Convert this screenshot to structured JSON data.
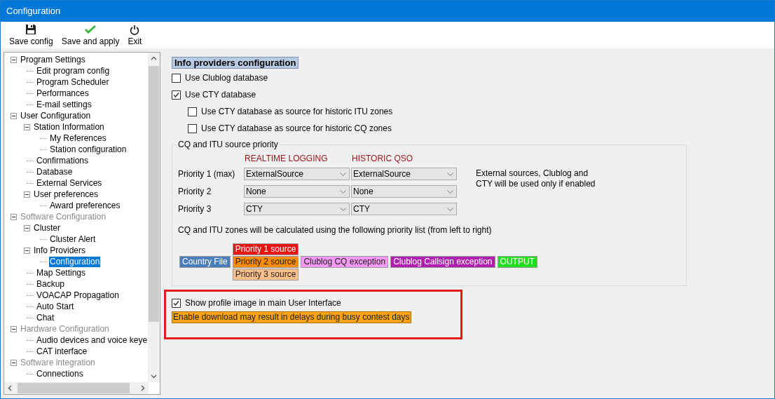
{
  "window": {
    "title": "Configuration"
  },
  "toolbar": [
    {
      "kind": "save",
      "label": "Save config"
    },
    {
      "kind": "apply",
      "label": "Save and apply"
    },
    {
      "kind": "exit",
      "label": "Exit"
    }
  ],
  "tree": [
    {
      "label": "Program Settings",
      "disabled": false,
      "expanded": true,
      "selected": false,
      "children": [
        {
          "label": "Edit program config",
          "selected": false
        },
        {
          "label": "Program Scheduler",
          "selected": false
        },
        {
          "label": "Performances",
          "selected": false
        },
        {
          "label": "E-mail settings",
          "selected": false
        }
      ]
    },
    {
      "label": "User Configuration",
      "disabled": false,
      "expanded": true,
      "selected": false,
      "children": [
        {
          "label": "Station Information",
          "expanded": true,
          "selected": false,
          "children": [
            {
              "label": "My References",
              "selected": false
            },
            {
              "label": "Station configuration",
              "selected": false
            }
          ]
        },
        {
          "label": "Confirmations",
          "selected": false
        },
        {
          "label": "Database",
          "selected": false
        },
        {
          "label": "External Services",
          "selected": false
        },
        {
          "label": "User preferences",
          "expanded": true,
          "selected": false,
          "children": [
            {
              "label": "Award preferences",
              "selected": false
            }
          ]
        }
      ]
    },
    {
      "label": "Software Configuration",
      "disabled": true,
      "expanded": true,
      "selected": false,
      "children": [
        {
          "label": "Cluster",
          "expanded": true,
          "selected": false,
          "children": [
            {
              "label": "Cluster Alert",
              "selected": false
            }
          ]
        },
        {
          "label": "Info Providers",
          "expanded": true,
          "selected": false,
          "children": [
            {
              "label": "Configuration",
              "selected": true
            }
          ]
        },
        {
          "label": "Map Settings",
          "selected": false
        },
        {
          "label": "Backup",
          "selected": false
        },
        {
          "label": "VOACAP Propagation",
          "selected": false
        },
        {
          "label": "Auto Start",
          "selected": false
        },
        {
          "label": "Chat",
          "selected": false
        }
      ]
    },
    {
      "label": "Hardware Configuration",
      "disabled": true,
      "expanded": true,
      "selected": false,
      "children": [
        {
          "label": "Audio devices and voice keye",
          "selected": false
        },
        {
          "label": "CAT interface",
          "selected": false
        }
      ]
    },
    {
      "label": "Software integration",
      "disabled": true,
      "expanded": true,
      "selected": false,
      "children": [
        {
          "label": "Connections",
          "selected": false
        }
      ]
    }
  ],
  "heading": "Info providers configuration",
  "options": [
    {
      "label": "Use Clublog database",
      "checked": false,
      "indented": false
    },
    {
      "label": "Use CTY database",
      "checked": true,
      "indented": false
    },
    {
      "label": "Use CTY database as source for historic ITU zones",
      "checked": false,
      "indented": true
    },
    {
      "label": "Use CTY database as source for historic CQ zones",
      "checked": false,
      "indented": true
    }
  ],
  "priority_group": {
    "title": "CQ and ITU source priority",
    "columns": [
      "REALTIME LOGGING",
      "HISTORIC QSO"
    ],
    "rows": [
      {
        "label": "Priority 1 (max)",
        "values": [
          "ExternalSource",
          "ExternalSource"
        ]
      },
      {
        "label": "Priority 2",
        "values": [
          "None",
          "None"
        ]
      },
      {
        "label": "Priority 3",
        "values": [
          "CTY",
          "CTY"
        ]
      }
    ],
    "note": "External sources, Clublog and CTY will be used only if enabled",
    "explanation": "CQ and ITU zones will be calculated using the following priority list (from left to right)",
    "chain": [
      [
        {
          "label": "Country File",
          "color": "#4a7ebb"
        }
      ],
      [
        {
          "label": "Priority 1 source",
          "color": "#e81414"
        },
        {
          "label": "Priority 2 source",
          "color": "#ff8c00"
        },
        {
          "label": "Priority 3 source",
          "color": "#ffc08a"
        }
      ],
      [
        {
          "label": "Clublog CQ exception",
          "color": "#f49af4"
        }
      ],
      [
        {
          "label": "Clublog Callsign exception",
          "color": "#b01fb0"
        }
      ],
      [
        {
          "label": "OUTPUT",
          "color": "#22dd22"
        }
      ]
    ]
  },
  "profile": {
    "label": "Show profile image in main User Interface",
    "checked": true,
    "warning": "Enable download may result in delays during busy contest days"
  }
}
